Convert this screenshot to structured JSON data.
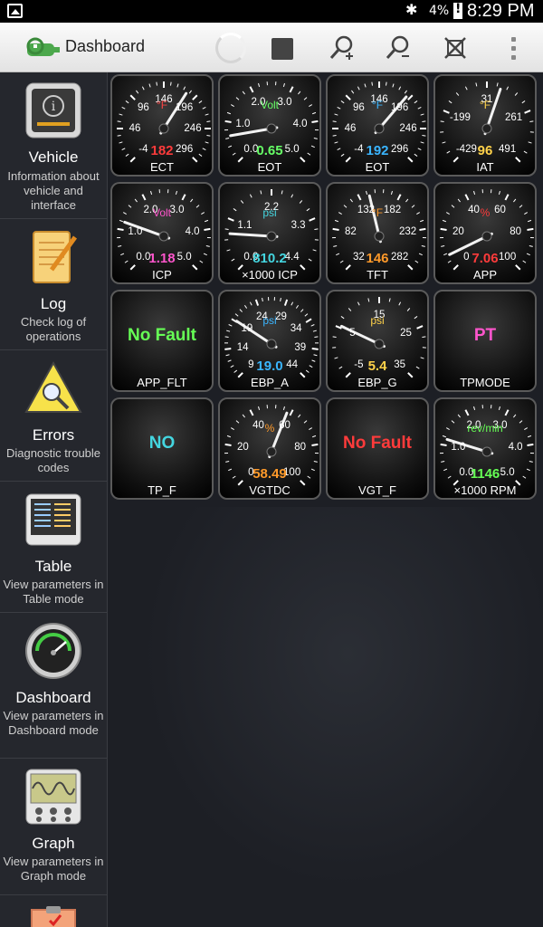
{
  "status": {
    "battery": "4%",
    "clock": "8:29 PM"
  },
  "title": "Dashboard",
  "sidebar": [
    {
      "title": "Vehicle",
      "desc": "Information about vehicle and interface",
      "icon": "info-icon"
    },
    {
      "title": "Log",
      "desc": "Check log of operations",
      "icon": "notepad-icon"
    },
    {
      "title": "Errors",
      "desc": "Diagnostic trouble codes",
      "icon": "warning-icon"
    },
    {
      "title": "Table",
      "desc": "View parameters in Table mode",
      "icon": "table-icon"
    },
    {
      "title": "Dashboard",
      "desc": "View parameters in Dashboard mode",
      "icon": "gauge-icon"
    },
    {
      "title": "Graph",
      "desc": "View parameters in Graph mode",
      "icon": "oscilloscope-icon"
    }
  ],
  "gauges": [
    {
      "name": "ECT",
      "type": "dial",
      "unit": "°F",
      "unitColor": "#ff4444",
      "value": "182",
      "valueColor": "#ff3b3b",
      "ticks": [
        "-4",
        "46",
        "96",
        "146",
        "196",
        "246",
        "296"
      ],
      "needle": 0.62
    },
    {
      "name": "EOT",
      "type": "dial",
      "unit": "Volt",
      "unitColor": "#66ff66",
      "value": "0.65",
      "valueColor": "#66ff66",
      "ticks": [
        "0.0",
        "1.0",
        "2.0",
        "3.0",
        "4.0",
        "5.0"
      ],
      "needle": 0.13
    },
    {
      "name": "EOT",
      "type": "dial",
      "unit": "°F",
      "unitColor": "#3ab5ff",
      "value": "192",
      "valueColor": "#3ab5ff",
      "ticks": [
        "-4",
        "46",
        "96",
        "146",
        "196",
        "246",
        "296"
      ],
      "needle": 0.65
    },
    {
      "name": "IAT",
      "type": "dial",
      "unit": "°F",
      "unitColor": "#ffd24a",
      "value": "96",
      "valueColor": "#ffd24a",
      "ticks": [
        "-429",
        "-199",
        "31",
        "261",
        "491"
      ],
      "needle": 0.57
    },
    {
      "name": "ICP",
      "type": "dial",
      "unit": "Volt",
      "unitColor": "#ff55cc",
      "value": "1.18",
      "valueColor": "#ff55cc",
      "ticks": [
        "0.0",
        "1.0",
        "2.0",
        "3.0",
        "4.0",
        "5.0"
      ],
      "needle": 0.24
    },
    {
      "name": "×1000 ICP",
      "type": "dial",
      "unit": "psi",
      "unitColor": "#44d6e0",
      "value": "810.2",
      "valueColor": "#44d6e0",
      "ticks": [
        "0.0",
        "1.1",
        "2.2",
        "3.3",
        "4.4"
      ],
      "needle": 0.18
    },
    {
      "name": "TFT",
      "type": "dial",
      "unit": "°F",
      "unitColor": "#ff9a2a",
      "value": "146",
      "valueColor": "#ff9a2a",
      "ticks": [
        "32",
        "82",
        "132",
        "182",
        "232",
        "282"
      ],
      "needle": 0.45
    },
    {
      "name": "APP",
      "type": "dial",
      "unit": "%",
      "unitColor": "#ff3b3b",
      "value": "7.06",
      "valueColor": "#ff3b3b",
      "ticks": [
        "0",
        "20",
        "40",
        "60",
        "80",
        "100"
      ],
      "needle": 0.07
    },
    {
      "name": "APP_FLT",
      "type": "text",
      "text": "No Fault",
      "textColor": "#66ff55"
    },
    {
      "name": "EBP_A",
      "type": "dial",
      "unit": "psi",
      "unitColor": "#3ab5ff",
      "value": "19.0",
      "valueColor": "#3ab5ff",
      "ticks": [
        "9",
        "14",
        "19",
        "24",
        "29",
        "34",
        "39",
        "44"
      ],
      "needle": 0.29
    },
    {
      "name": "EBP_G",
      "type": "dial",
      "unit": "psi",
      "unitColor": "#ffd24a",
      "value": "5.4",
      "valueColor": "#ffd24a",
      "ticks": [
        "-5",
        "5",
        "15",
        "25",
        "35"
      ],
      "needle": 0.26
    },
    {
      "name": "TPMODE",
      "type": "text",
      "text": "PT",
      "textColor": "#ff55cc"
    },
    {
      "name": "TP_F",
      "type": "text",
      "text": "NO",
      "textColor": "#44d6e0"
    },
    {
      "name": "VGTDC",
      "type": "dial",
      "unit": "%",
      "unitColor": "#ff9a2a",
      "value": "58.49",
      "valueColor": "#ff9a2a",
      "ticks": [
        "0",
        "20",
        "40",
        "60",
        "80",
        "100"
      ],
      "needle": 0.58
    },
    {
      "name": "VGT_F",
      "type": "text",
      "text": "No Fault",
      "textColor": "#ff3b3b"
    },
    {
      "name": "×1000 RPM",
      "type": "dial",
      "unit": "rev/min",
      "unitColor": "#66ff55",
      "value": "1146",
      "valueColor": "#66ff55",
      "ticks": [
        "0.0",
        "1.0",
        "2.0",
        "3.0",
        "4.0",
        "5.0"
      ],
      "needle": 0.23
    }
  ]
}
